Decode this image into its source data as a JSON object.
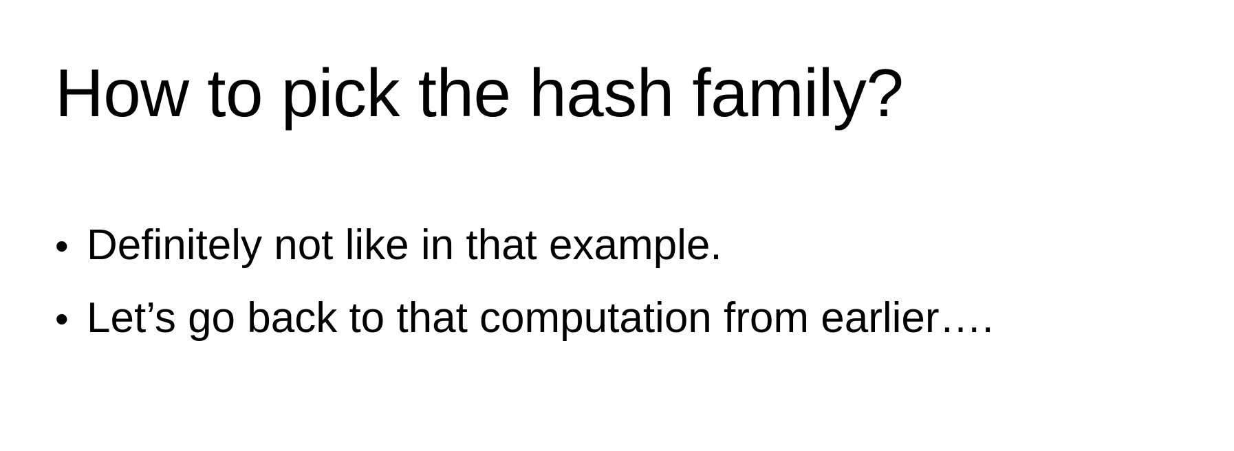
{
  "slide": {
    "title": "How to pick the hash family?",
    "bullets": [
      "Definitely not like in that example.",
      "Let’s go back to that computation from earlier…."
    ],
    "bullet_symbol": "•"
  }
}
